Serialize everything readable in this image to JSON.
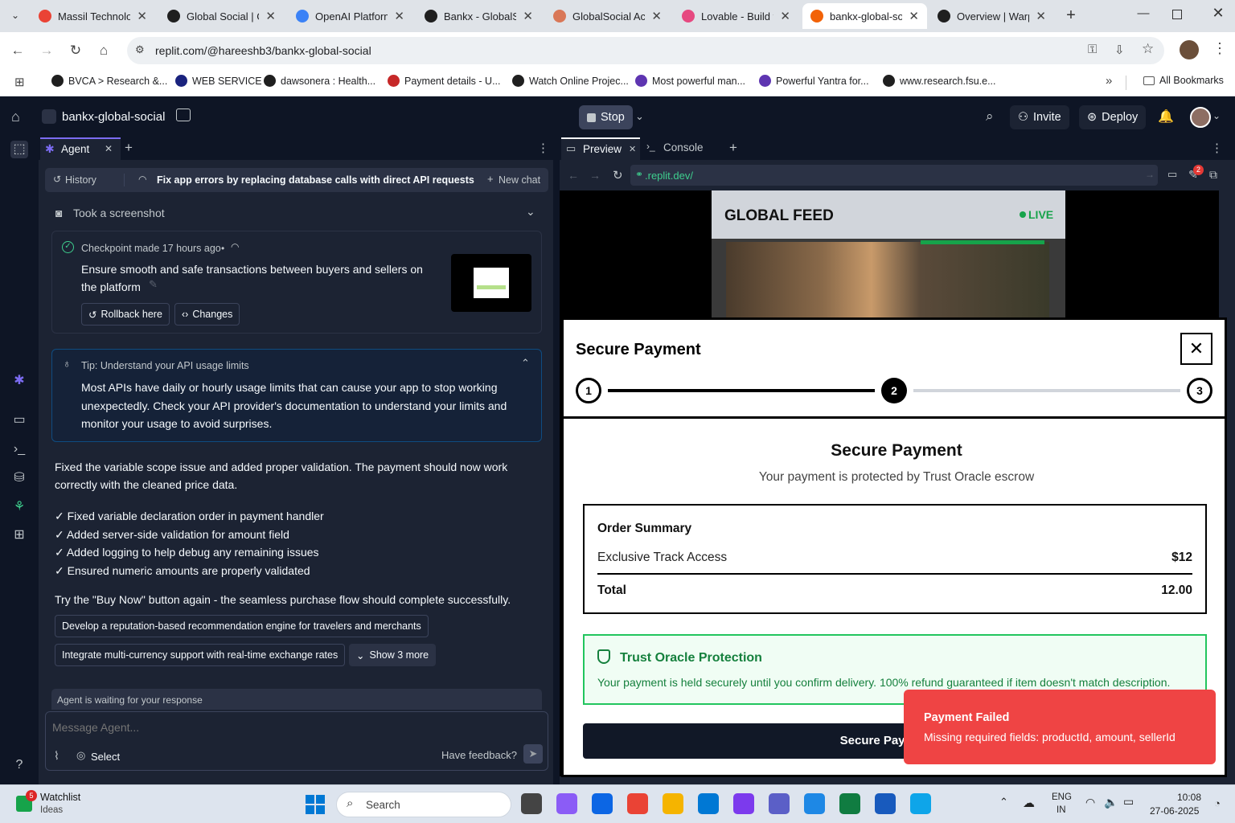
{
  "browser": {
    "tabs": [
      {
        "title": "Massil Technolog",
        "favicon": "gmail-icon",
        "color": "#ea4335"
      },
      {
        "title": "Global Social | Gl",
        "favicon": "bolt-icon",
        "color": "#1f1f1f"
      },
      {
        "title": "OpenAI Platform",
        "favicon": "openai-icon",
        "color": "#3b82f6"
      },
      {
        "title": "Bankx - GlobalSo",
        "favicon": "github-icon",
        "color": "#1f1f1f"
      },
      {
        "title": "GlobalSocial Acq",
        "favicon": "claude-icon",
        "color": "#d97757"
      },
      {
        "title": "Lovable - Build f",
        "favicon": "lovable-icon",
        "color": "#e64980"
      },
      {
        "title": "bankx-global-so",
        "favicon": "replit-icon",
        "color": "#f26207"
      },
      {
        "title": "Overview | Warp",
        "favicon": "notion-icon",
        "color": "#1f1f1f"
      }
    ],
    "url": "replit.com/@hareeshb3/bankx-global-social",
    "bookmarks": [
      {
        "label": "BVCA > Research &...",
        "color": "#1f1f1f"
      },
      {
        "label": "WEB SERVICE",
        "color": "#1a237e"
      },
      {
        "label": "dawsonera : Health...",
        "color": "#1f1f1f"
      },
      {
        "label": "Payment details - U...",
        "color": "#c62828"
      },
      {
        "label": "Watch Online Projec...",
        "color": "#1f1f1f"
      },
      {
        "label": "Most powerful man...",
        "color": "#5e35b1"
      },
      {
        "label": "Powerful Yantra for...",
        "color": "#5e35b1"
      },
      {
        "label": "www.research.fsu.e...",
        "color": "#1f1f1f"
      }
    ],
    "all_bookmarks": "All Bookmarks"
  },
  "replit": {
    "project": "bankx-global-social",
    "stop": "Stop",
    "invite": "Invite",
    "deploy": "Deploy"
  },
  "agent": {
    "tab": "Agent",
    "history": "History",
    "chat_title": "Fix app errors by replacing database calls with direct API requests",
    "new_chat": "New chat",
    "screenshot": "Took a screenshot",
    "checkpoint": {
      "meta": "Checkpoint made 17 hours ago",
      "dot": "•",
      "text": "Ensure smooth and safe transactions between buyers and sellers on the platform",
      "rollback": "Rollback here",
      "changes": "Changes"
    },
    "tip": {
      "title": "Tip: Understand your API usage limits",
      "body": "Most APIs have daily or hourly usage limits that can cause your app to stop working unexpectedly. Check your API provider's documentation to understand your limits and monitor your usage to avoid surprises."
    },
    "message": "Fixed the variable scope issue and added proper validation. The payment should now work correctly with the cleaned price data.",
    "checklist": [
      "✓ Fixed variable declaration order in payment handler",
      "✓ Added server-side validation for amount field",
      "✓ Added logging to help debug any remaining issues",
      "✓ Ensured numeric amounts are properly validated"
    ],
    "try_again": "Try the \"Buy Now\" button again - the seamless purchase flow should complete successfully.",
    "suggestions": [
      "Develop a reputation-based recommendation engine for travelers and merchants",
      "Integrate multi-currency support with real-time exchange rates"
    ],
    "show_more": "Show 3 more",
    "waiting": "Agent is waiting for your response",
    "placeholder": "Message Agent...",
    "select": "Select",
    "feedback": "Have feedback?"
  },
  "preview": {
    "tab_preview": "Preview",
    "tab_console": "Console",
    "url": ".replit.dev/",
    "badge": "2",
    "feed_title": "GLOBAL FEED",
    "live": "LIVE"
  },
  "modal": {
    "title": "Secure Payment",
    "steps": [
      "1",
      "2",
      "3"
    ],
    "current_step": 2,
    "heading": "Secure Payment",
    "subheading": "Your payment is protected by Trust Oracle escrow",
    "summary_title": "Order Summary",
    "item_name": "Exclusive Track Access",
    "item_price": "$12",
    "total_label": "Total",
    "total_value": "12.00",
    "protection_title": "Trust Oracle Protection",
    "protection_text": "Your payment is held securely until you confirm delivery. 100% refund guaranteed if item doesn't match description.",
    "pay_button": "Secure Payment wi"
  },
  "toast": {
    "title": "Payment Failed",
    "message": "Missing required fields: productId, amount, sellerId"
  },
  "taskbar": {
    "watchlist": "Watchlist",
    "ideas": "Ideas",
    "watch_badge": "5",
    "search": "Search",
    "lang1": "ENG",
    "lang2": "IN",
    "time": "10:08",
    "date": "27-06-2025"
  }
}
